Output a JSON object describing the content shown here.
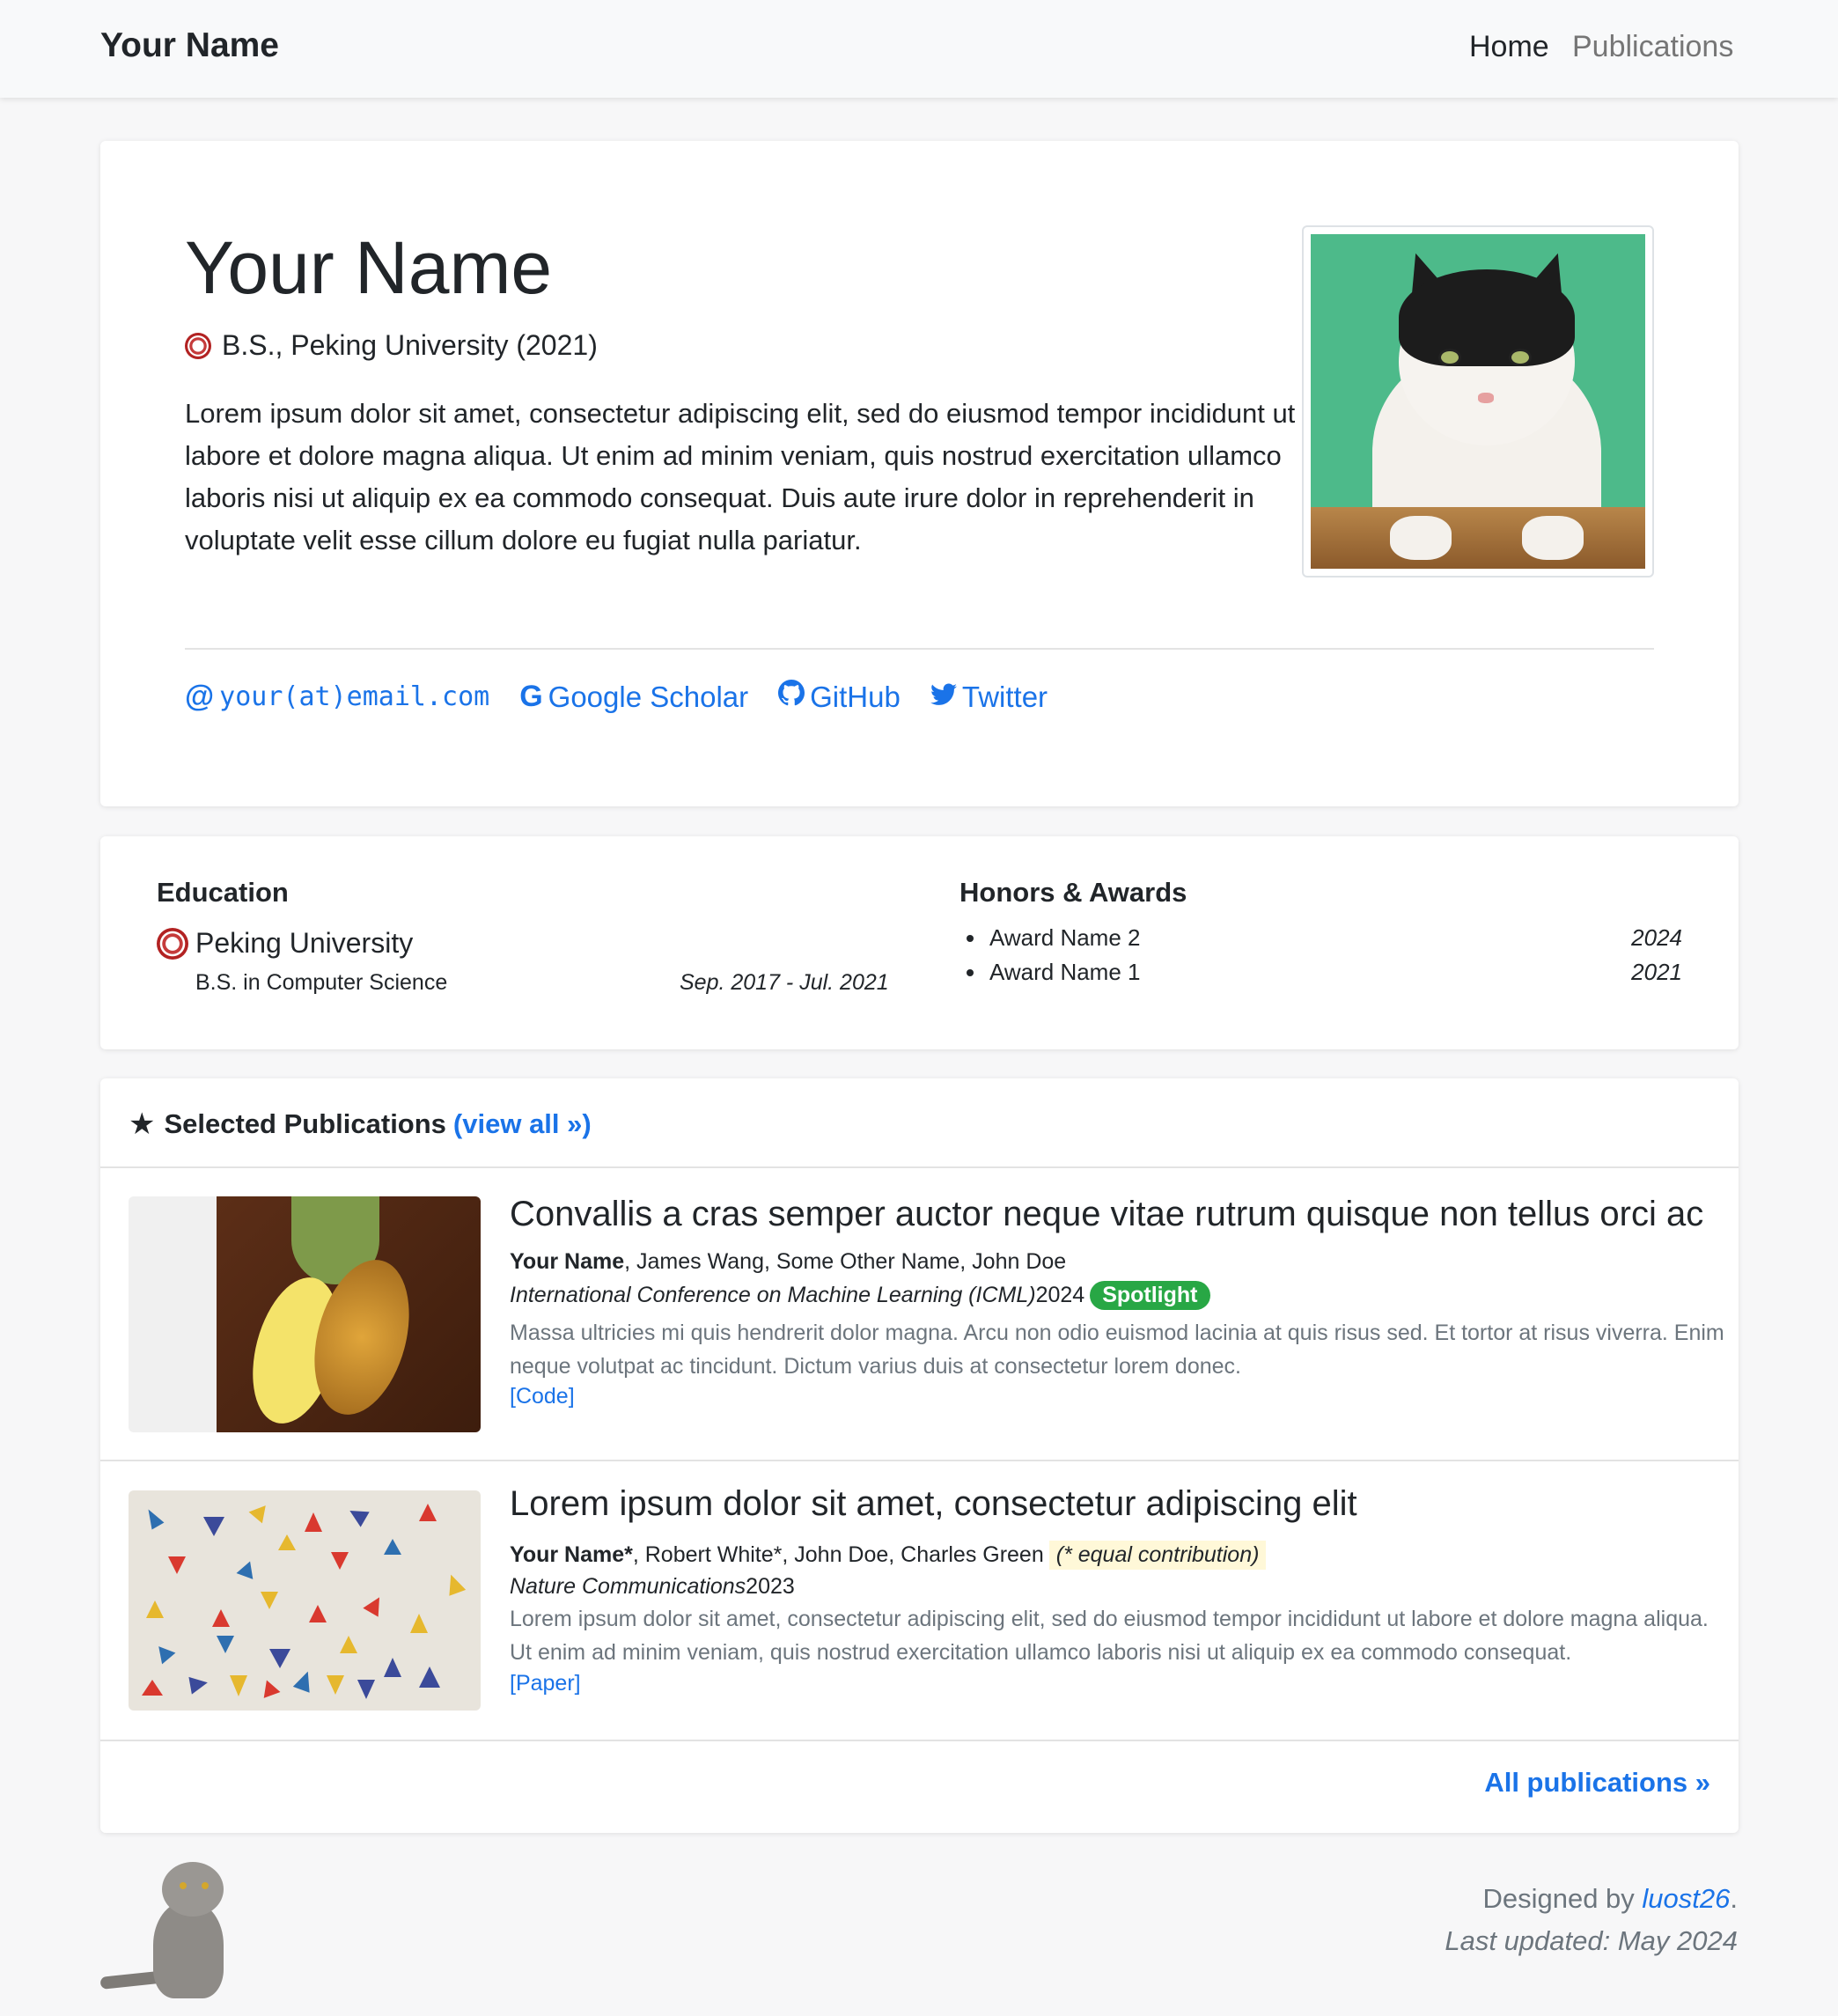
{
  "nav": {
    "brand": "Your Name",
    "home": "Home",
    "publications": "Publications"
  },
  "intro": {
    "name": "Your Name",
    "degree": "B.S., Peking University (2021)",
    "bio": "Lorem ipsum dolor sit amet, consectetur adipiscing elit, sed do eiusmod tempor incididunt ut labore et dolore magna aliqua. Ut enim ad minim veniam, quis nostrud exercitation ullamco laboris nisi ut aliquip ex ea commodo consequat. Duis aute irure dolor in reprehenderit in voluptate velit esse cillum dolore eu fugiat nulla pariatur.",
    "links": {
      "email": "your(at)email.com",
      "scholar": "Google Scholar",
      "github": "GitHub",
      "twitter": "Twitter"
    }
  },
  "education": {
    "title": "Education",
    "school": "Peking University",
    "major": "B.S. in Computer Science",
    "period": "Sep. 2017 - Jul. 2021"
  },
  "honors": {
    "title": "Honors & Awards",
    "items": [
      {
        "name": "Award Name 2",
        "year": "2024"
      },
      {
        "name": "Award Name 1",
        "year": "2021"
      }
    ]
  },
  "publications": {
    "header": "Selected Publications",
    "view_all": "(view all",
    "view_all_suffix": ")",
    "items": [
      {
        "title": "Convallis a cras semper auctor neque vitae rutrum quisque non tellus orci ac",
        "lead_author": "Your Name",
        "other_authors": ", James Wang, Some Other Name, John Doe",
        "venue": "International Conference on Machine Learning (ICML)",
        "year": " 2024",
        "badge": "Spotlight",
        "abstract": "Massa ultricies mi quis hendrerit dolor magna. Arcu non odio euismod lacinia at quis risus sed. Et tortor at risus viverra. Enim neque volutpat ac tincidunt. Dictum varius duis at consectetur lorem donec.",
        "link": "[Code]"
      },
      {
        "title": "Lorem ipsum dolor sit amet, consectetur adipiscing elit",
        "lead_author": "Your Name*",
        "other_authors": ", Robert White*, John Doe, Charles Green",
        "equal": "(* equal contribution)",
        "venue": "Nature Communications",
        "year": " 2023",
        "abstract": "Lorem ipsum dolor sit amet, consectetur adipiscing elit, sed do eiusmod tempor incididunt ut labore et dolore magna aliqua. Ut enim ad minim veniam, quis nostrud exercitation ullamco laboris nisi ut aliquip ex ea commodo consequat.",
        "link": "[Paper]"
      }
    ],
    "all_link": "All publications"
  },
  "footer": {
    "designed_by": "Designed by ",
    "designer": "luost26",
    "period": ".",
    "updated": "Last updated: May 2024"
  },
  "colors": {
    "accent": "#1a73e8",
    "badge": "#28a745",
    "muted": "#6c757d"
  }
}
